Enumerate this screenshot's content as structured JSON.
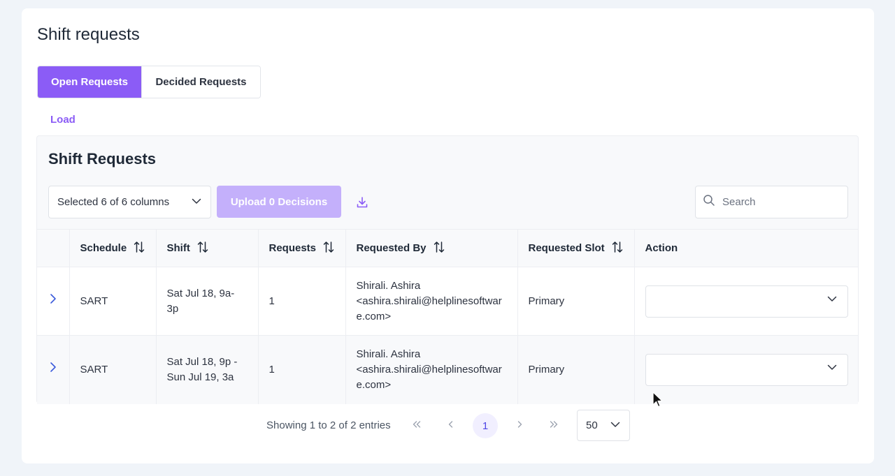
{
  "page": {
    "title": "Shift requests"
  },
  "tabs": [
    {
      "label": "Open Requests",
      "active": true
    },
    {
      "label": "Decided Requests",
      "active": false
    }
  ],
  "load_label": "Load",
  "panel": {
    "title": "Shift Requests",
    "column_select": "Selected 6 of 6 columns",
    "upload_label": "Upload 0 Decisions",
    "search_placeholder": "Search"
  },
  "table": {
    "columns": [
      "Schedule",
      "Shift",
      "Requests",
      "Requested By",
      "Requested Slot",
      "Action"
    ],
    "rows": [
      {
        "schedule": "SART",
        "shift": [
          "Sat Jul 18, 9a-",
          "3p"
        ],
        "requests": "1",
        "requested_by": [
          "Shirali. Ashira",
          "<ashira.shirali@helplinesoftwar",
          "e.com>"
        ],
        "slot": "Primary",
        "action": ""
      },
      {
        "schedule": "SART",
        "shift": [
          "Sat Jul 18, 9p -",
          "Sun Jul 19, 3a"
        ],
        "requests": "1",
        "requested_by": [
          "Shirali. Ashira",
          "<ashira.shirali@helplinesoftwar",
          "e.com>"
        ],
        "slot": "Primary",
        "action": ""
      }
    ]
  },
  "pagination": {
    "info": "Showing 1 to 2 of 2 entries",
    "current_page": "1",
    "page_size": "50"
  },
  "colors": {
    "accent": "#8b5cf6",
    "accent_disabled": "#c4b0fb",
    "chevron_blue": "#3b5bdb"
  }
}
